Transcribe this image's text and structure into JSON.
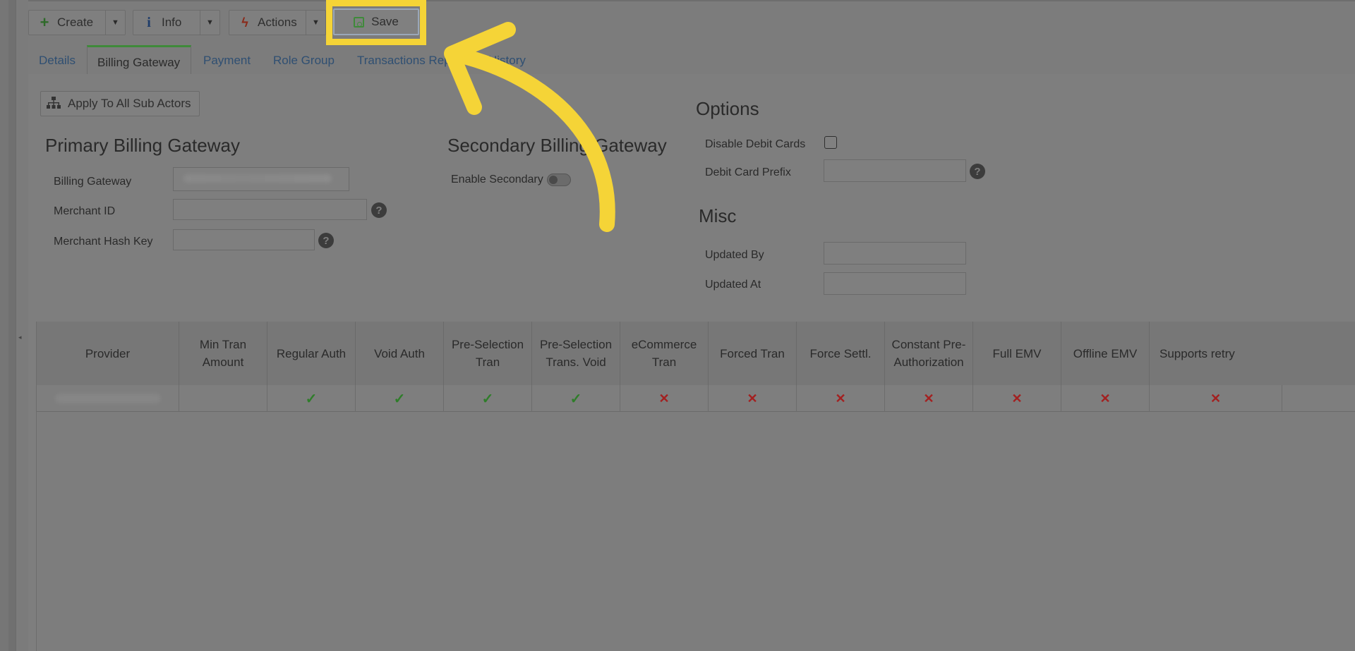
{
  "toolbar": {
    "create_label": "Create",
    "info_label": "Info",
    "actions_label": "Actions",
    "save_label": "Save"
  },
  "tabs": [
    {
      "label": "Details"
    },
    {
      "label": "Billing Gateway"
    },
    {
      "label": "Payment"
    },
    {
      "label": "Role Group"
    },
    {
      "label": "Transactions Rep"
    },
    {
      "label": "History"
    }
  ],
  "apply_button": {
    "label": "Apply To All Sub Actors"
  },
  "primary": {
    "title": "Primary Billing Gateway",
    "billing_gateway_label": "Billing Gateway",
    "merchant_id_label": "Merchant ID",
    "merchant_hash_label": "Merchant Hash Key",
    "merchant_id_value": "",
    "merchant_hash_value": ""
  },
  "secondary": {
    "title": "Secondary Billing Gateway",
    "enable_label": "Enable Secondary"
  },
  "options": {
    "title": "Options",
    "disable_debit_label": "Disable Debit Cards",
    "debit_prefix_label": "Debit Card Prefix",
    "debit_prefix_value": ""
  },
  "misc": {
    "title": "Misc",
    "updated_by_label": "Updated By",
    "updated_at_label": "Updated At",
    "updated_by_value": "",
    "updated_at_value": ""
  },
  "table": {
    "headers": [
      "Provider",
      "Min Tran Amount",
      "Regular Auth",
      "Void Auth",
      "Pre-Selection Tran",
      "Pre-Selection Trans. Void",
      "eCommerce Tran",
      "Forced Tran",
      "Force Settl.",
      "Constant Pre-Authorization",
      "Full EMV",
      "Offline EMV",
      "Supports retry"
    ],
    "row": [
      "",
      "",
      "✓",
      "✓",
      "✓",
      "✓",
      "✕",
      "✕",
      "✕",
      "✕",
      "✕",
      "✕",
      "✕"
    ]
  },
  "colors": {
    "accent_highlight": "#f5d437",
    "check": "#2f7d2a",
    "cross": "#a32020",
    "tab_active_border": "#3f8a3a"
  }
}
